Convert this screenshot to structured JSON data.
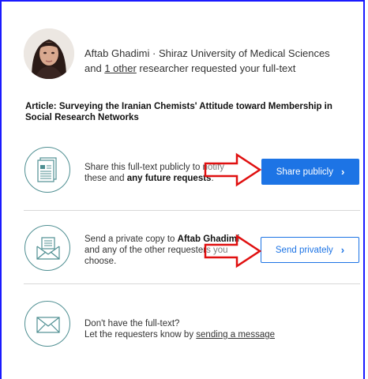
{
  "requester": {
    "name": "Aftab Ghadimi",
    "separator": " · ",
    "institution": "Shiraz University of Medical Sciences",
    "line2_prefix": "and ",
    "other_link": "1 other",
    "line2_suffix": " researcher requested your full-text"
  },
  "article": {
    "label": "Article:",
    "title": " Surveying the Iranian Chemists' Attitude toward Membership in Social Research Networks"
  },
  "share_public": {
    "text_line1": "Share this full-text publicly to notify",
    "text_line2_prefix": "these and ",
    "text_line2_bold": "any future requests",
    "text_line2_suffix": ".",
    "button_label": "Share publicly",
    "button_chevron": "›",
    "icon": "document-chart-icon"
  },
  "send_private": {
    "text_line1_prefix": "Send a private copy to ",
    "text_line1_bold": "Aftab Ghadimi",
    "text_line2": "and any of the other requesters you",
    "text_line3": "choose.",
    "button_label": "Send privately",
    "button_chevron": "›",
    "icon": "envelope-document-icon"
  },
  "message": {
    "text_line1": "Don't have the full-text?",
    "text_line2_prefix": "Let the requesters know by ",
    "text_line2_link": "sending a message",
    "icon": "envelope-icon"
  },
  "colors": {
    "accent": "#1d74e5",
    "icon_stroke": "#4f8f92",
    "annotation_arrow": "#e01010",
    "frame_border": "#1a1aff"
  }
}
